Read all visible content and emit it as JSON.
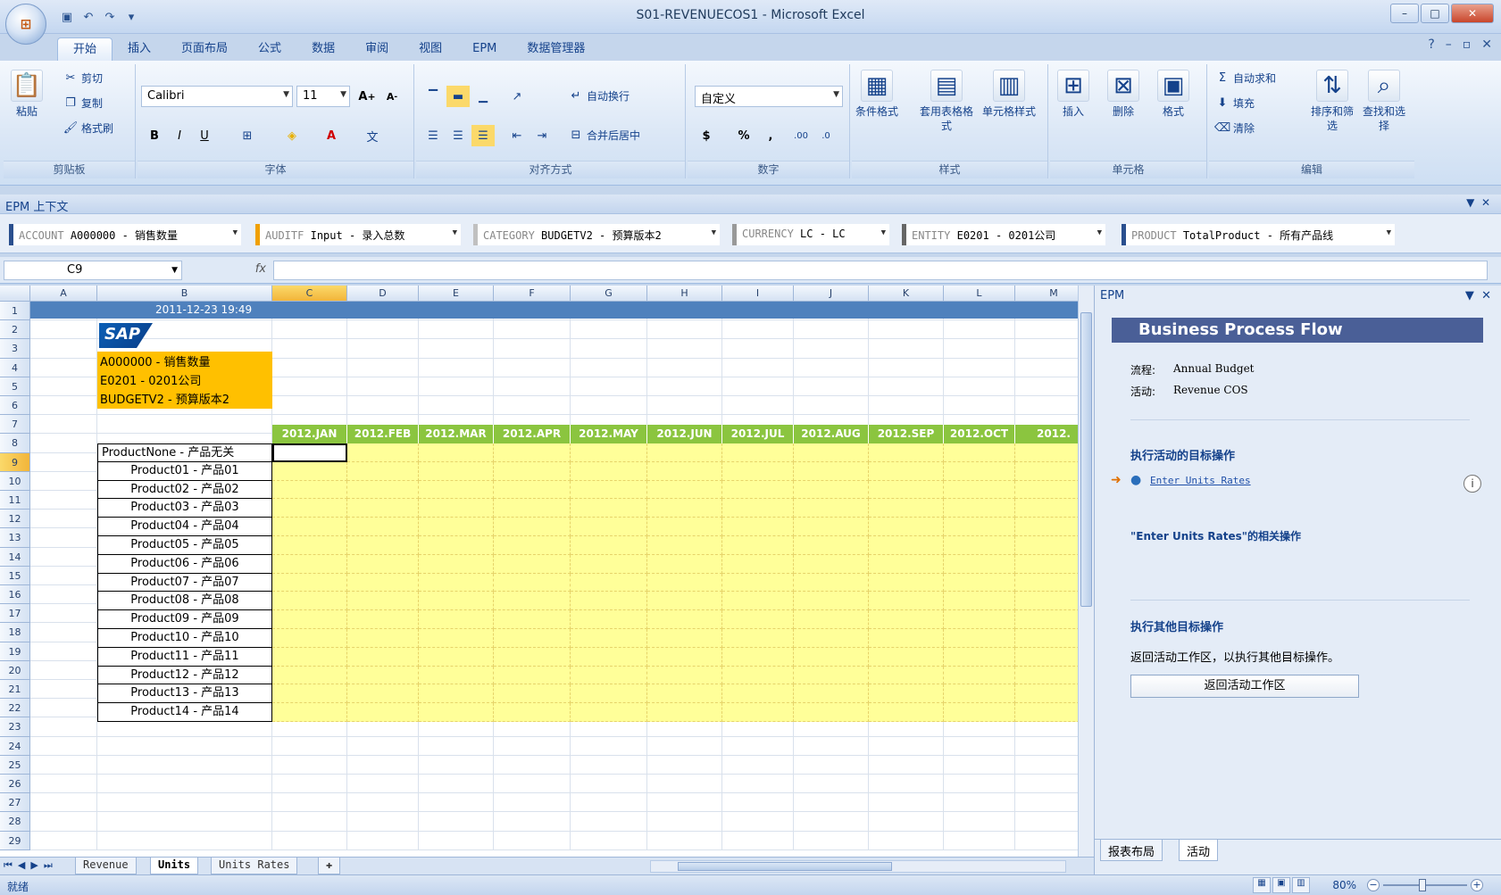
{
  "window": {
    "title": "S01-REVENUECOS1 - Microsoft Excel",
    "office_button": "Office"
  },
  "ribbon_tabs": [
    "开始",
    "插入",
    "页面布局",
    "公式",
    "数据",
    "审阅",
    "视图",
    "EPM",
    "数据管理器"
  ],
  "ribbon": {
    "clipboard": {
      "paste": "粘贴",
      "cut": "剪切",
      "copy": "复制",
      "format_painter": "格式刷",
      "label": "剪贴板"
    },
    "font": {
      "font_name": "Calibri",
      "font_size": "11",
      "label": "字体",
      "bold": "B",
      "italic": "I",
      "underline": "U"
    },
    "alignment": {
      "wrap_text": "自动换行",
      "merge_center": "合并后居中",
      "label": "对齐方式"
    },
    "number": {
      "format": "自定义",
      "currency": "$",
      "percent": "%",
      "comma": ",",
      "label": "数字"
    },
    "styles": {
      "conditional": "条件格式",
      "table_format": "套用表格格式",
      "cell_styles": "单元格样式",
      "label": "样式"
    },
    "cells": {
      "insert": "插入",
      "delete": "删除",
      "format": "格式",
      "label": "单元格"
    },
    "editing": {
      "autosum": "自动求和",
      "fill": "填充",
      "clear": "清除",
      "sort_filter": "排序和筛选",
      "find_select": "查找和选择",
      "label": "编辑"
    }
  },
  "epm_context": {
    "title": "EPM 上下文",
    "items": [
      {
        "dim": "ACCOUNT",
        "value": "A000000 - 销售数量"
      },
      {
        "dim": "AUDITF",
        "value": "Input - 录入总数"
      },
      {
        "dim": "CATEGORY",
        "value": "BUDGETV2 - 预算版本2"
      },
      {
        "dim": "CURRENCY",
        "value": "LC - LC"
      },
      {
        "dim": "ENTITY",
        "value": "E0201 - 0201公司"
      },
      {
        "dim": "PRODUCT",
        "value": "TotalProduct - 所有产品线"
      }
    ]
  },
  "formula_bar": {
    "name_box": "C9",
    "fx": "fx",
    "formula": ""
  },
  "sheet": {
    "columns": [
      "A",
      "B",
      "C",
      "D",
      "E",
      "F",
      "G",
      "H",
      "I",
      "J",
      "K",
      "L",
      "M"
    ],
    "rows": [
      "1",
      "2",
      "3",
      "4",
      "5",
      "6",
      "7",
      "8",
      "9",
      "10",
      "11",
      "12",
      "13",
      "14",
      "15",
      "16",
      "17",
      "18",
      "19",
      "20",
      "21",
      "22",
      "23",
      "24",
      "25",
      "26",
      "27",
      "28",
      "29"
    ],
    "timestamp": "2011-12-23 19:49",
    "logo": "SAP",
    "header_block": [
      "A000000 - 销售数量",
      "E0201 - 0201公司",
      "BUDGETV2 - 预算版本2"
    ],
    "months": [
      "2012.JAN",
      "2012.FEB",
      "2012.MAR",
      "2012.APR",
      "2012.MAY",
      "2012.JUN",
      "2012.JUL",
      "2012.AUG",
      "2012.SEP",
      "2012.OCT",
      "2012."
    ],
    "products": [
      "ProductNone - 产品无关",
      "Product01 - 产品01",
      "Product02 - 产品02",
      "Product03 - 产品03",
      "Product04 - 产品04",
      "Product05 - 产品05",
      "Product06 - 产品06",
      "Product07 - 产品07",
      "Product08 - 产品08",
      "Product09 - 产品09",
      "Product10 - 产品10",
      "Product11 - 产品11",
      "Product12 - 产品12",
      "Product13 - 产品13",
      "Product14 - 产品14"
    ]
  },
  "sheet_tabs": [
    "Revenue",
    "Units",
    "Units Rates"
  ],
  "epm_pane": {
    "header": "EPM",
    "title": "Business Process Flow",
    "process_label": "流程:",
    "process_value": "Annual Budget",
    "activity_label": "活动:",
    "activity_value": "Revenue  COS",
    "section_target": "执行活动的目标操作",
    "link": "Enter Units  Rates",
    "related": "\"Enter Units Rates\"的相关操作",
    "section_other": "执行其他目标操作",
    "other_desc": "返回活动工作区，以执行其他目标操作。",
    "button": "返回活动工作区",
    "tabs": [
      "报表布局",
      "活动"
    ]
  },
  "status": {
    "ready": "就绪",
    "zoom": "80%"
  },
  "colors": {
    "month_header": "#8bc53f",
    "input_area": "#ffff99",
    "header_block": "#ffc000",
    "timestamp_bar": "#4f81bd",
    "bpf_title": "#4a5f97"
  }
}
